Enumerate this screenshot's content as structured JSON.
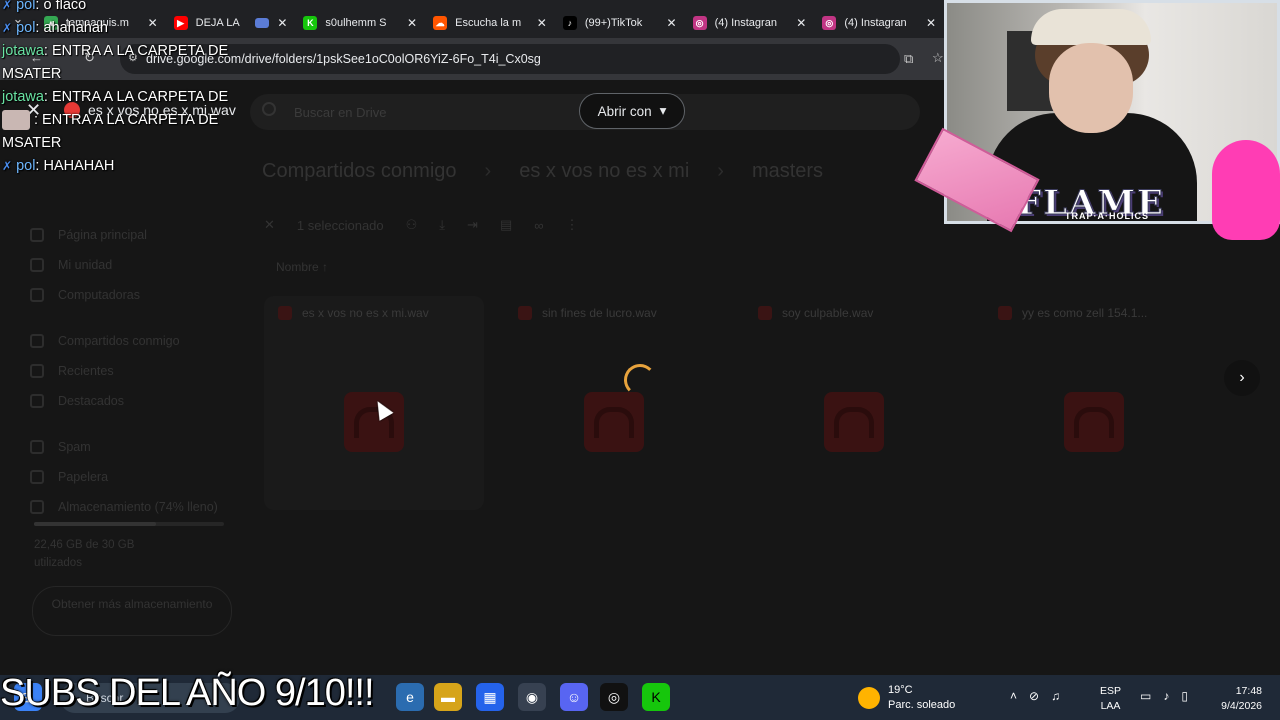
{
  "browser": {
    "tabs": [
      {
        "title": "temaaguis.m",
        "color": "#34a853",
        "glyph": "▲"
      },
      {
        "title": "DEJA LA",
        "color": "#ff0000",
        "glyph": "▶"
      },
      {
        "title": "s0ulhemm S",
        "color": "#16c60c",
        "glyph": "K"
      },
      {
        "title": "Escucha la m",
        "color": "#ff5500",
        "glyph": "☁"
      },
      {
        "title": "(99+)TikTok",
        "color": "#000000",
        "glyph": "♪"
      },
      {
        "title": "(4) Instagran",
        "color": "#c13584",
        "glyph": "◎"
      },
      {
        "title": "(4) Instagran",
        "color": "#c13584",
        "glyph": "◎"
      }
    ],
    "url": "drive.google.com/drive/folders/1pskSee1oC0olOR6YiZ-6Fo_T4i_Cx0sg"
  },
  "drive": {
    "search_placeholder": "Buscar en Drive",
    "breadcrumbs": [
      "Compartidos conmigo",
      "es x vos no es x mi",
      "masters"
    ],
    "selection": "1 seleccionado",
    "column_name": "Nombre",
    "sidebar": [
      "Página principal",
      "Mi unidad",
      "Computadoras",
      "Compartidos conmigo",
      "Recientes",
      "Destacados",
      "Spam",
      "Papelera",
      "Almacenamiento (74% lleno)"
    ],
    "storage_text": "22,46 GB de 30 GB utilizados",
    "get_more": "Obtener más almacenamiento",
    "files": [
      "es x vos no es x mi.wav",
      "sin fines de lucro.wav",
      "soy culpable.wav",
      "yy es como zell 154.1..."
    ]
  },
  "preview": {
    "file_title": "es x vos no es x mi.wav",
    "open_with": "Abrir con"
  },
  "chat": [
    {
      "user": "pol",
      "text": ": o flaco",
      "style": "pol"
    },
    {
      "user": "pol",
      "text": ": ahahahah",
      "style": "pol"
    },
    {
      "user": "jotawa",
      "text": ": ENTRA A LA CARPETA DE MSATER",
      "style": "jota"
    },
    {
      "user": "jotawa",
      "text": ": ENTRA A LA CARPETA DE",
      "style": "jota"
    },
    {
      "user": "",
      "text": ": ENTRA A LA CARPETA DE MSATER",
      "style": "avatar"
    },
    {
      "user": "pol",
      "text": ": HAHAHAH",
      "style": "pol"
    }
  ],
  "overlay": {
    "logo": "FLAME",
    "logo_sub": "TRAP·A·HOLICS",
    "caption": "SUBS DEL AÑO 9/10!!!"
  },
  "taskbar": {
    "search": "Buscar",
    "weather_temp": "19°C",
    "weather_desc": "Parc. soleado",
    "lang1": "ESP",
    "lang2": "LAA",
    "time": "17:48",
    "date": "9/4/2026"
  }
}
